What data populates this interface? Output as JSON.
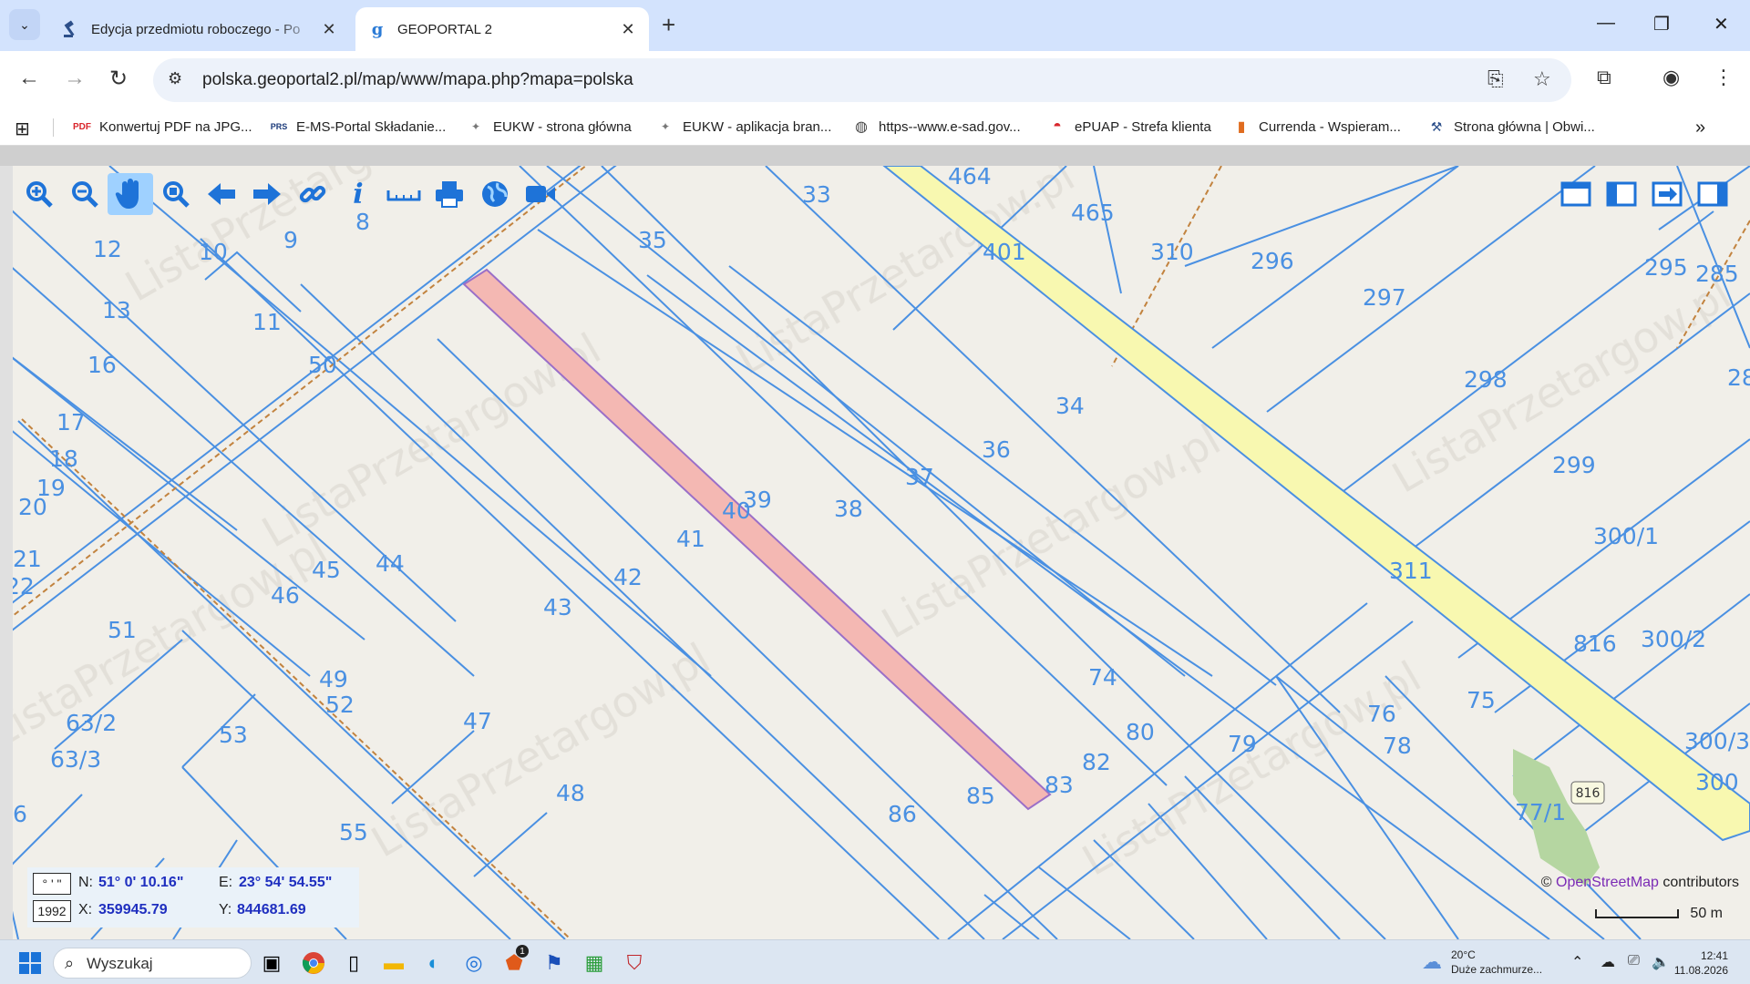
{
  "browser": {
    "tabs": [
      {
        "title": "Edycja przedmiotu roboczego - Po",
        "close": "✕"
      },
      {
        "title": "GEOPORTAL 2",
        "close": "✕"
      }
    ],
    "new_tab": "+",
    "url": "polska.geoportal2.pl/map/www/mapa.php?mapa=polska",
    "bookmarks": [
      {
        "label": "Konwertuj PDF na JPG...",
        "icon": "pdf24-icon"
      },
      {
        "label": "E-MS-Portal Składanie...",
        "icon": "prs-icon"
      },
      {
        "label": "EUKW - strona główna",
        "icon": "eagle-icon"
      },
      {
        "label": "EUKW - aplikacja bran...",
        "icon": "eagle-icon"
      },
      {
        "label": "https--www.e-sad.gov...",
        "icon": "globe-icon"
      },
      {
        "label": "ePUAP - Strefa klienta",
        "icon": "epuap-icon"
      },
      {
        "label": "Currenda - Wspieram...",
        "icon": "currenda-icon"
      },
      {
        "label": "Strona główna | Obwi...",
        "icon": "gavel-icon"
      }
    ],
    "more_bookmarks": "»"
  },
  "map": {
    "parcel_labels": [
      "33",
      "464",
      "465",
      "401",
      "310",
      "296",
      "297",
      "295",
      "285",
      "28",
      "12",
      "10",
      "9",
      "8",
      "35",
      "13",
      "11",
      "50",
      "16",
      "17",
      "18",
      "19",
      "20",
      "21",
      "22",
      "298",
      "34",
      "36",
      "37",
      "299",
      "39",
      "40",
      "38",
      "41",
      "300/1",
      "311",
      "45",
      "44",
      "46",
      "42",
      "43",
      "51",
      "300/2",
      "74",
      "75",
      "816",
      "49",
      "47",
      "76",
      "78",
      "63/2",
      "63/3",
      "52",
      "53",
      "79",
      "80",
      "82",
      "83",
      "300/3",
      "300",
      "85",
      "86",
      "77/1",
      "48",
      "6",
      "55"
    ],
    "road_number": "816",
    "coords": {
      "format_dms": "° ' \"",
      "format_epsg": "1992",
      "n_label": "N:",
      "n_value": "51° 0' 10.16\"",
      "e_label": "E:",
      "e_value": "23° 54' 54.55\"",
      "x_label": "X:",
      "x_value": "359945.79",
      "y_label": "Y:",
      "y_value": "844681.69"
    },
    "attribution_prefix": "©",
    "attribution_link": "OpenStreetMap",
    "attribution_suffix": "contributors",
    "scale": "50 m",
    "tools": [
      "zoom-in-icon",
      "zoom-out-icon",
      "pan-hand-icon",
      "zoom-box-icon",
      "back-arrow-icon",
      "forward-arrow-icon",
      "link-icon",
      "info-icon",
      "measure-icon",
      "print-icon",
      "globe-icon",
      "video-icon"
    ],
    "watermark": "ListaPrzetargow.pl"
  },
  "taskbar": {
    "search_placeholder": "Wyszukaj",
    "weather_temp": "20°C",
    "weather_desc": "Duże zachmurze...",
    "time": "12:41",
    "date": "11.08.2026",
    "notification_badge": "1"
  },
  "colors": {
    "parcel_line": "#4a90e2",
    "highlight_fill": "#f4b8b3",
    "road_fill": "#f8f8b0",
    "map_bg": "#f1efe9"
  }
}
